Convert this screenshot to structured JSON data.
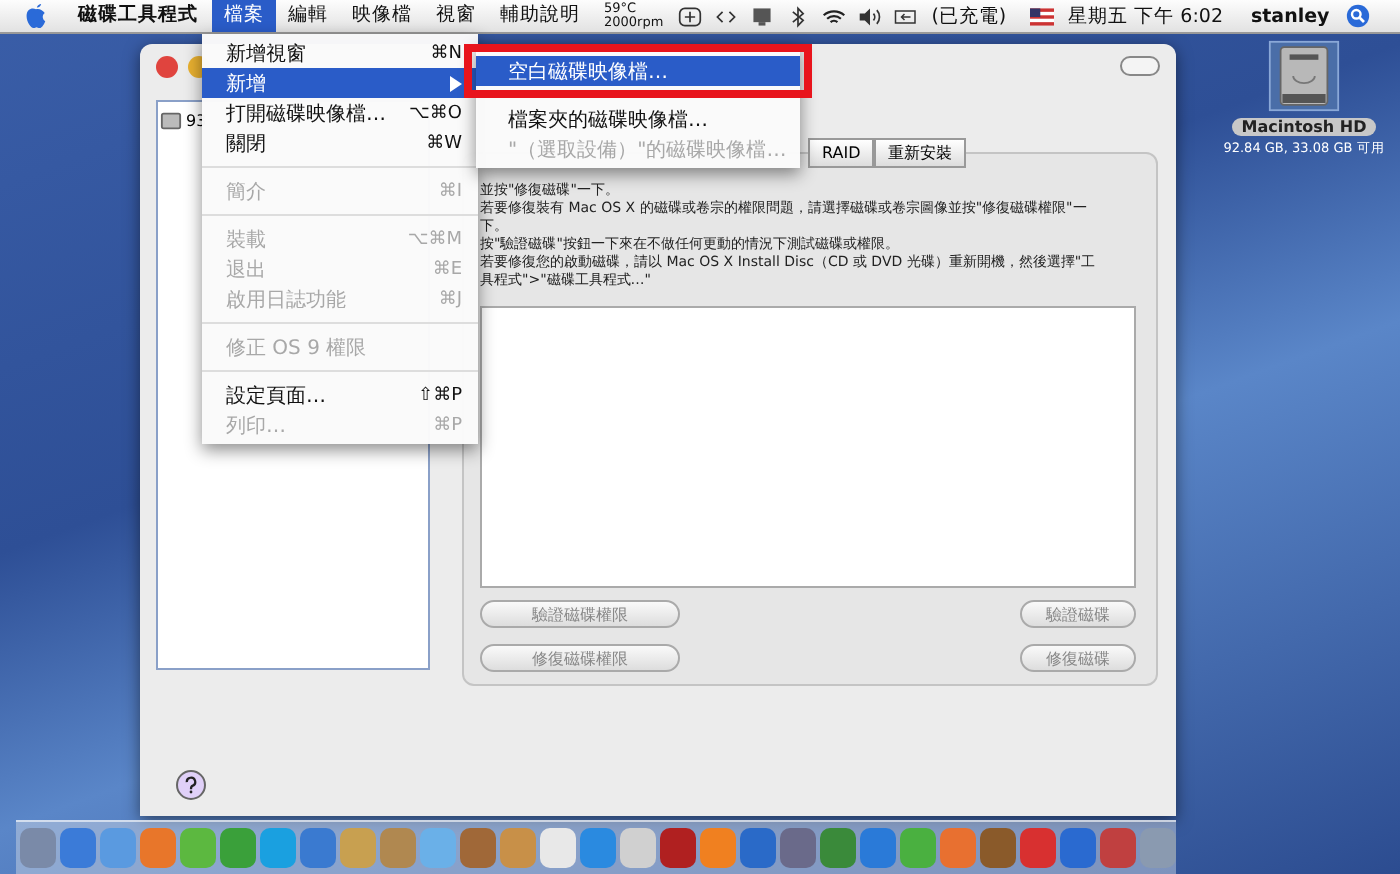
{
  "menubar": {
    "app_name": "磁碟工具程式",
    "menus": [
      {
        "label": "檔案",
        "selected": true
      },
      {
        "label": "編輯",
        "selected": false
      },
      {
        "label": "映像檔",
        "selected": false
      },
      {
        "label": "視窗",
        "selected": false
      },
      {
        "label": "輔助說明",
        "selected": false
      }
    ],
    "temperature": "59°C",
    "fan_speed": "2000rpm",
    "battery_status": "(已充電)",
    "clock": "星期五 下午 6:02",
    "user": "stanley"
  },
  "file_menu": [
    {
      "kind": "item",
      "label": "新增視窗",
      "shortcut": "⌘N",
      "disabled": false,
      "selected": false,
      "submenu": false
    },
    {
      "kind": "item",
      "label": "新增",
      "disabled": false,
      "selected": true,
      "submenu": true
    },
    {
      "kind": "item",
      "label": "打開磁碟映像檔…",
      "shortcut": "⌥⌘O",
      "disabled": false,
      "selected": false,
      "submenu": false
    },
    {
      "kind": "item",
      "label": "關閉",
      "shortcut": "⌘W",
      "disabled": false,
      "selected": false,
      "submenu": false
    },
    {
      "kind": "separator"
    },
    {
      "kind": "item",
      "label": "簡介",
      "shortcut": "⌘I",
      "disabled": true,
      "selected": false,
      "submenu": false
    },
    {
      "kind": "separator"
    },
    {
      "kind": "item",
      "label": "裝載",
      "shortcut": "⌥⌘M",
      "disabled": true,
      "selected": false,
      "submenu": false
    },
    {
      "kind": "item",
      "label": "退出",
      "shortcut": "⌘E",
      "disabled": true,
      "selected": false,
      "submenu": false
    },
    {
      "kind": "item",
      "label": "啟用日誌功能",
      "shortcut": "⌘J",
      "disabled": true,
      "selected": false,
      "submenu": false
    },
    {
      "kind": "separator"
    },
    {
      "kind": "item",
      "label": "修正 OS 9 權限",
      "disabled": true,
      "selected": false,
      "submenu": false
    },
    {
      "kind": "separator"
    },
    {
      "kind": "item",
      "label": "設定頁面…",
      "shortcut": "⇧⌘P",
      "disabled": false,
      "selected": false,
      "submenu": false
    },
    {
      "kind": "item",
      "label": "列印…",
      "shortcut": "⌘P",
      "disabled": true,
      "selected": false,
      "submenu": false
    }
  ],
  "new_submenu": [
    {
      "kind": "item",
      "label": "空白磁碟映像檔…",
      "disabled": false,
      "selected": true,
      "highlighted": true
    },
    {
      "kind": "separator"
    },
    {
      "kind": "item",
      "label": "檔案夾的磁碟映像檔…",
      "disabled": false,
      "selected": false,
      "highlighted": false
    },
    {
      "kind": "item",
      "label": "\"（選取設備）\"的磁碟映像檔…",
      "disabled": true,
      "selected": false,
      "highlighted": false
    }
  ],
  "sidebar": {
    "items": [
      {
        "label": "93",
        "selected": false
      }
    ]
  },
  "tabs": [
    {
      "label": "RAID",
      "selected": false
    },
    {
      "label": "重新安裝",
      "selected": false
    }
  ],
  "info_lines": [
    "並按\"修復磁碟\"一下。",
    "若要修復裝有 Mac OS X 的磁碟或卷宗的權限問題，請選擇磁碟或卷宗圖像並按\"修復磁碟權限\"一",
    "下。",
    "按\"驗證磁碟\"按鈕一下來在不做任何更動的情況下測試磁碟或權限。",
    "若要修復您的啟動磁碟，請以 Mac OS X Install Disc（CD 或 DVD 光碟）重新開機，然後選擇\"工",
    "具程式\">\"磁碟工具程式…\""
  ],
  "buttons": [
    {
      "label": "驗證磁碟權限",
      "disabled": true
    },
    {
      "label": "驗證磁碟",
      "disabled": true
    },
    {
      "label": "修復磁碟權限",
      "disabled": true
    },
    {
      "label": "修復磁碟",
      "disabled": true
    }
  ],
  "desktop_icon": {
    "name": "Macintosh HD",
    "info": "92.84 GB, 33.08 GB 可用"
  }
}
